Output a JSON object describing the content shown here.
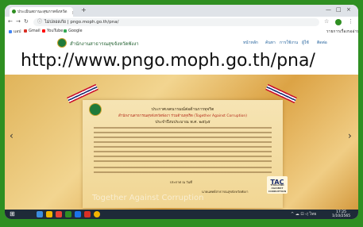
{
  "browser": {
    "tab_title": "ประเมินสถานะสุขภาพจังหวัด",
    "new_tab_symbol": "+",
    "close_symbol": "×",
    "window_controls": [
      "—",
      "□",
      "×"
    ],
    "url": "ไม่ปลอดภัย | pngo.moph.go.th/pna/",
    "lock_symbol": "ⓘ",
    "back_symbol": "←",
    "forward_symbol": "→",
    "reload_symbol": "↻",
    "star_symbol": "☆",
    "menu_symbol": "⋮"
  },
  "bookmarks": [
    {
      "label": "แอป",
      "color": "#4285f4"
    },
    {
      "label": "Gmail",
      "color": "#d93025"
    },
    {
      "label": "YouTube",
      "color": "#ff0000"
    },
    {
      "label": "Google",
      "color": "#34a853"
    }
  ],
  "reading_list": "รายการเรื่องรออ่าน",
  "site": {
    "name": "สำนักงานสาธารณสุขจังหวัดพังงา",
    "menu": [
      "หน้าหลัก",
      "ค้นหา",
      "การใช้งาน",
      "ผู้ใช้",
      "ติดต่อ"
    ]
  },
  "overlay_url": "http://www.pngo.moph.go.th/pna/",
  "slider": {
    "prev_symbol": "‹",
    "next_symbol": "›",
    "poster": {
      "title": "ประกาศเจตนารมณ์ต่อต้านการทุจริต",
      "subtitle": "สำนักงานสาธารณสุขจังหวัดพังงา ร่วมต้านทุจริต (Together Against Corruption)",
      "year_line": "ประจำปีงบประมาณ พ.ศ. ๒๕๖๕",
      "signature": "ประกาศ ณ วันที่",
      "signer": "นายแพทย์สาธารณสุขจังหวัดพังงา",
      "watermark": "Together Against Corruption",
      "logo": "TAC",
      "logo_sub": "THAILAND AGAINST CORRUPTION"
    }
  },
  "taskbar": {
    "start_symbol": "⊞",
    "time": "17:25",
    "date": "1/10/2565",
    "apps": [
      "#3c8dde",
      "#f2b600",
      "#e94235",
      "#2f8f22",
      "#1b73e8",
      "#d93025",
      "#f4b400"
    ],
    "tray": "^ ☁ ⊡ ◁ ไทย"
  }
}
